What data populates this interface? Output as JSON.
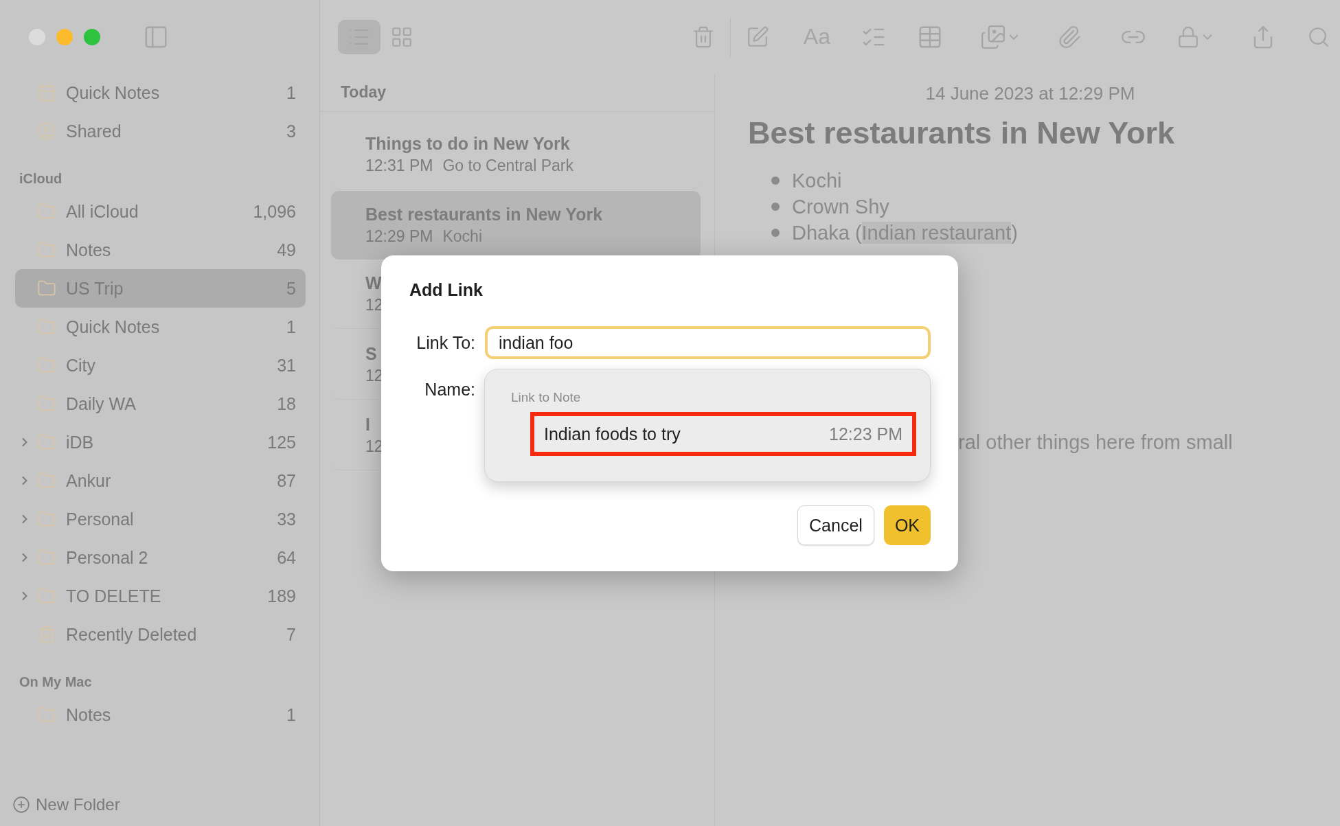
{
  "toolbar": {
    "views": [
      {
        "kind": "list",
        "selected": true
      },
      {
        "kind": "grid",
        "selected": false
      }
    ],
    "format_label": "Aa"
  },
  "sidebar": {
    "top_items": [
      {
        "kind": "quick-notes",
        "label": "Quick Notes",
        "count": "1",
        "selected": false
      },
      {
        "kind": "shared",
        "label": "Shared",
        "count": "3",
        "selected": false
      }
    ],
    "sections": [
      {
        "title": "iCloud",
        "items": [
          {
            "kind": "folder",
            "label": "All iCloud",
            "count": "1,096",
            "selected": false
          },
          {
            "kind": "folder",
            "label": "Notes",
            "count": "49",
            "selected": false
          },
          {
            "kind": "folder",
            "label": "US Trip",
            "count": "5",
            "selected": true
          },
          {
            "kind": "folder",
            "label": "Quick Notes",
            "count": "1",
            "selected": false
          },
          {
            "kind": "folder",
            "label": "City",
            "count": "31",
            "selected": false
          },
          {
            "kind": "folder",
            "label": "Daily WA",
            "count": "18",
            "selected": false
          },
          {
            "kind": "group",
            "label": "iDB",
            "count": "125",
            "selected": false
          },
          {
            "kind": "group",
            "label": "Ankur",
            "count": "87",
            "selected": false
          },
          {
            "kind": "group",
            "label": "Personal",
            "count": "33",
            "selected": false
          },
          {
            "kind": "group",
            "label": "Personal 2",
            "count": "64",
            "selected": false
          },
          {
            "kind": "group",
            "label": "TO DELETE",
            "count": "189",
            "selected": false
          },
          {
            "kind": "trash",
            "label": "Recently Deleted",
            "count": "7",
            "selected": false
          }
        ]
      },
      {
        "title": "On My Mac",
        "items": [
          {
            "kind": "folder",
            "label": "Notes",
            "count": "1",
            "selected": false
          }
        ]
      }
    ],
    "new_folder": "New Folder"
  },
  "note_list": {
    "header": "Today",
    "notes": [
      {
        "title": "Things to do in New York",
        "time": "12:31 PM",
        "preview": "Go to Central Park",
        "selected": false
      },
      {
        "title": "Best restaurants in New York",
        "time": "12:29 PM",
        "preview": "Kochi",
        "selected": true
      },
      {
        "title": "W",
        "time": "12",
        "selected": false
      },
      {
        "title": "S",
        "time": "12",
        "selected": false
      },
      {
        "title": "I",
        "time": "12",
        "selected": false
      }
    ]
  },
  "editor": {
    "date": "14 June 2023 at 12:29 PM",
    "title": "Best restaurants in New York",
    "bullets": [
      {
        "text": "Kochi"
      },
      {
        "text": "Crown Shy"
      },
      {
        "text": "Dhaka (",
        "selected_text": "Indian restaurant",
        "after": ")"
      }
    ],
    "paragraph": "ral other things here from small"
  },
  "dialog": {
    "title": "Add Link",
    "link_label": "Link To:",
    "link_value": "indian foo",
    "name_label": "Name:",
    "suggestions": {
      "header": "Link to Note",
      "items": [
        {
          "title": "Indian foods to try",
          "time": "12:23 PM",
          "highlighted": true
        }
      ]
    },
    "buttons": [
      {
        "label": "Cancel",
        "kind": "secondary"
      },
      {
        "label": "OK",
        "kind": "primary"
      }
    ]
  }
}
